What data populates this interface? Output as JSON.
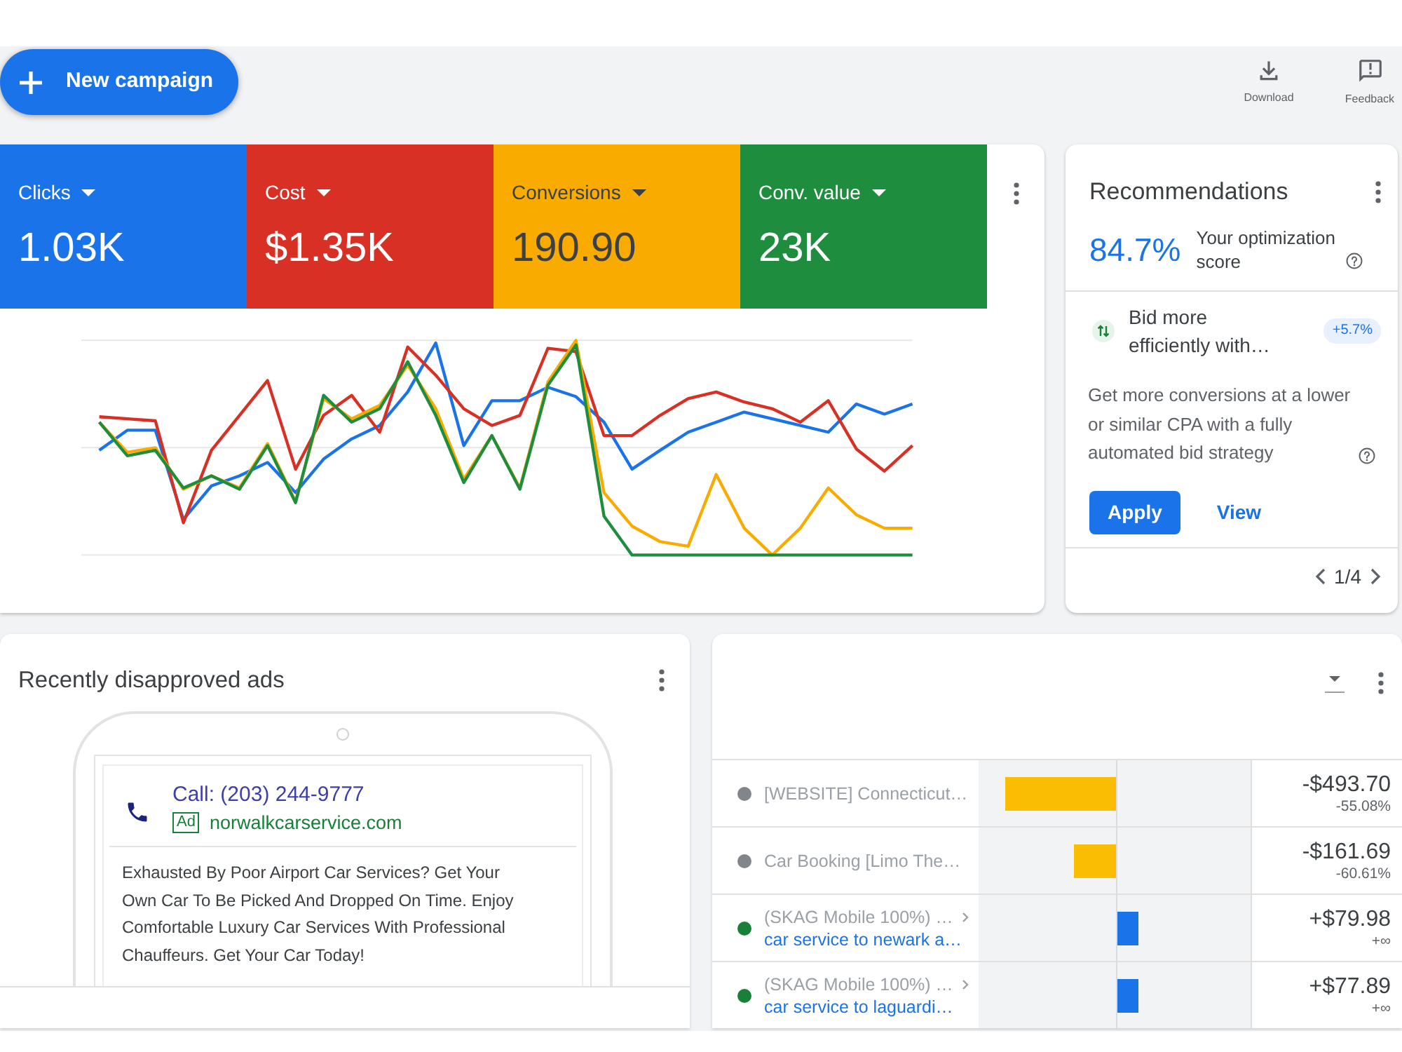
{
  "toolbar": {
    "primary_button": "New campaign",
    "actions": [
      {
        "kind": "download",
        "label": "Download"
      },
      {
        "kind": "feedback",
        "label": "Feedback"
      }
    ]
  },
  "metrics": [
    {
      "label": "Clicks",
      "value": "1.03K",
      "color": "#1a73e8"
    },
    {
      "label": "Cost",
      "value": "$1.35K",
      "color": "#d93025"
    },
    {
      "label": "Conversions",
      "value": "190.90",
      "color": "#f9ab00"
    },
    {
      "label": "Conv. value",
      "value": "23K",
      "color": "#1e8e3e"
    }
  ],
  "recommendations": {
    "title": "Recommendations",
    "score": "84.7%",
    "score_label": "Your optimization score",
    "suggestion": {
      "title": "Bid more efficiently with…",
      "uplift": "+5.7%",
      "description": "Get more conversions at a lower or similar CPA with a fully automated bid strategy",
      "buttons": [
        {
          "label": "Apply",
          "kind": "filled"
        },
        {
          "label": "View",
          "kind": "text"
        }
      ]
    },
    "pager": "1/4"
  },
  "disapproved_ads": {
    "title": "Recently disapproved ads",
    "ad": {
      "headline": "Call: (203) 244-9777",
      "badge": "Ad",
      "display_url": "norwalkcarservice.com",
      "description": "Exhausted By Poor Airport Car Services? Get Your Own Car To Be Picked And Dropped On Time. Enjoy Comfortable Luxury Car Services With Professional Chauffeurs. Get Your Car Today!"
    }
  },
  "changes_table": {
    "rows": [
      {
        "color": "#80868b",
        "campaign": "[WEBSITE] Connecticut…",
        "kind": "decrease",
        "level": 0.81,
        "value": "-$493.70",
        "change": "-55.08%"
      },
      {
        "color": "#80868b",
        "campaign": "Car Booking [Limo The…",
        "kind": "decrease",
        "level": 0.31,
        "value": "-$161.69",
        "change": "-60.61%"
      },
      {
        "color": "#188038",
        "campaign": "(SKAG Mobile 100%) …",
        "ad_group": "car service to newark a…",
        "kind": "increase",
        "level": 0.16,
        "value": "+$79.98",
        "change": "+∞"
      },
      {
        "color": "#188038",
        "campaign": "(SKAG Mobile 100%) …",
        "ad_group": "car service to laguardi…",
        "kind": "increase",
        "level": 0.16,
        "value": "+$77.89",
        "change": "+∞"
      }
    ]
  }
}
